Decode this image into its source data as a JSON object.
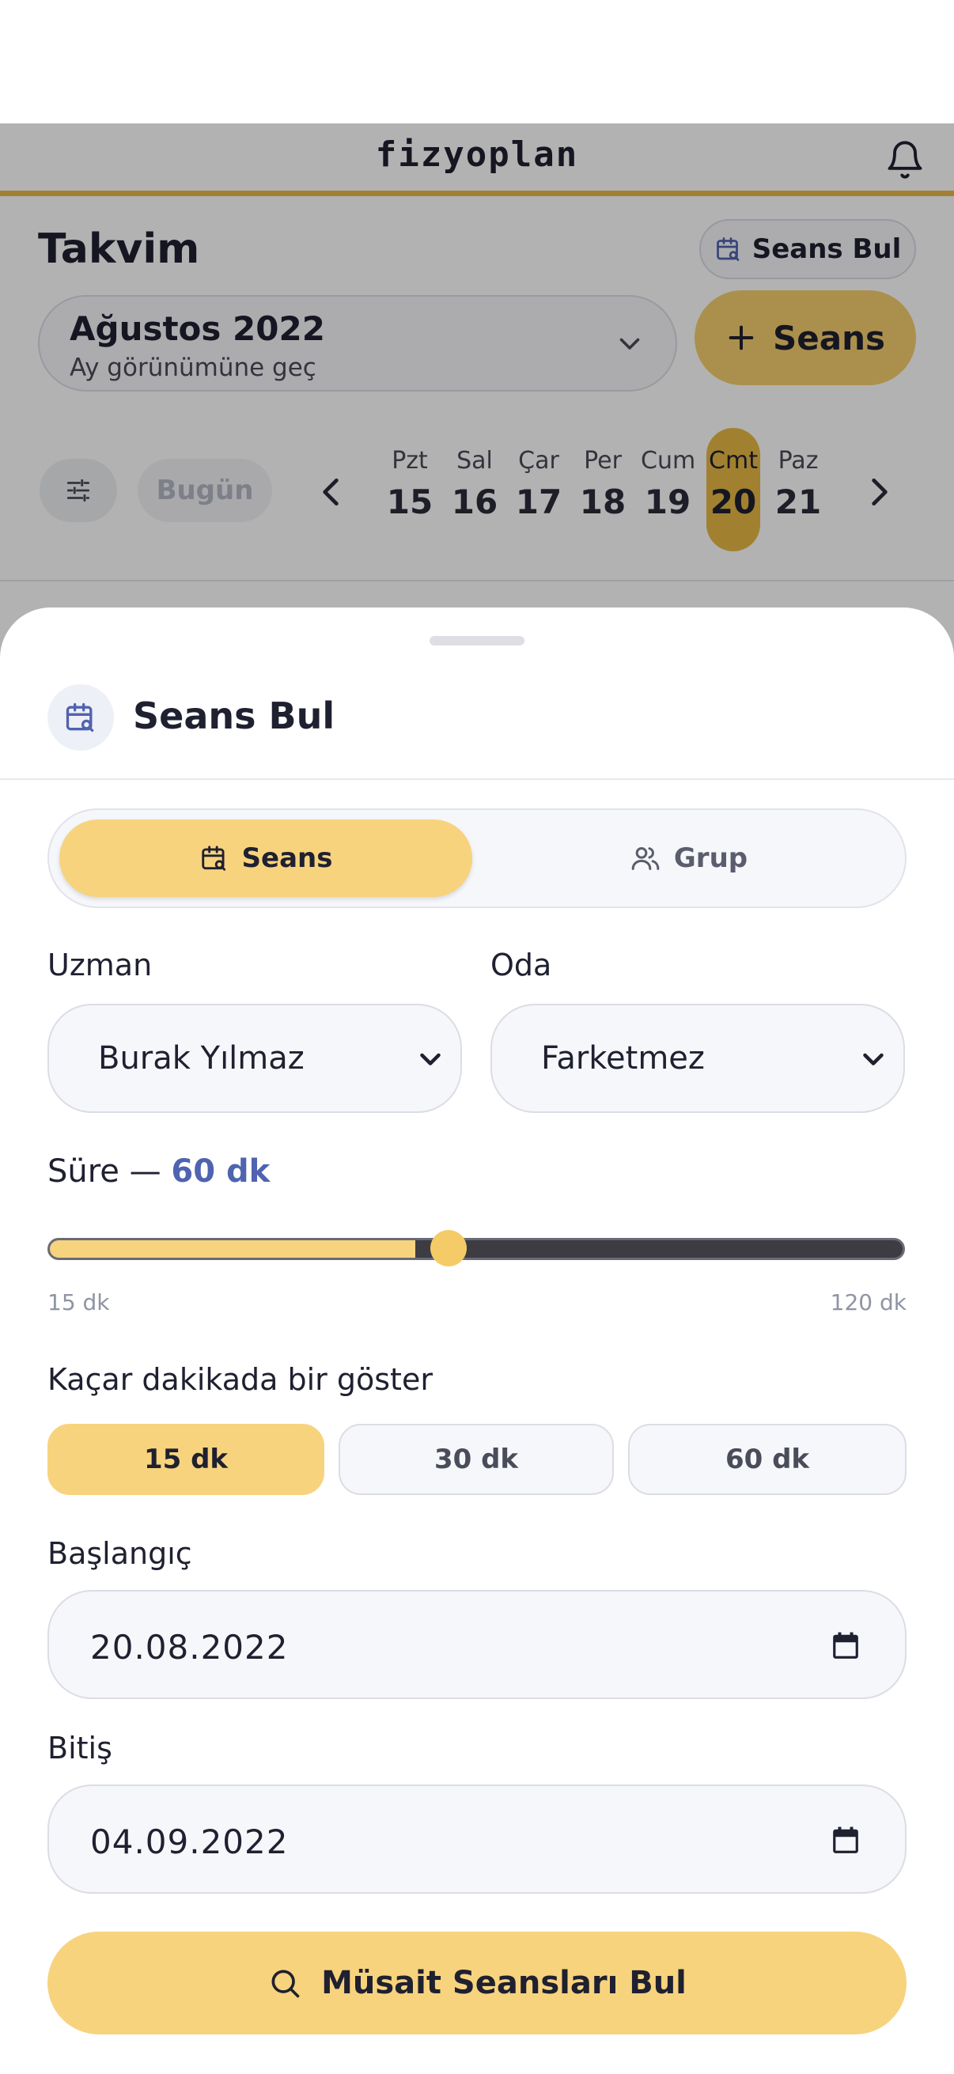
{
  "app": {
    "logo": "fizyoplan"
  },
  "header": {
    "title": "Takvim",
    "find_label": "Seans Bul",
    "month_title": "Ağustos 2022",
    "month_sub": "Ay görünümüne geç",
    "new_label": "Seans",
    "today_label": "Bugün"
  },
  "week": {
    "days": [
      {
        "name": "Pzt",
        "date": "15"
      },
      {
        "name": "Sal",
        "date": "16"
      },
      {
        "name": "Çar",
        "date": "17"
      },
      {
        "name": "Per",
        "date": "18"
      },
      {
        "name": "Cum",
        "date": "19"
      },
      {
        "name": "Cmt",
        "date": "20"
      },
      {
        "name": "Paz",
        "date": "21"
      }
    ],
    "selected_index": 5
  },
  "sheet": {
    "title": "Seans Bul",
    "tabs": [
      {
        "label": "Seans",
        "active": true
      },
      {
        "label": "Grup",
        "active": false
      }
    ],
    "specialist_label": "Uzman",
    "specialist_value": "Burak Yılmaz",
    "room_label": "Oda",
    "room_value": "Farketmez",
    "duration_prefix": "Süre —",
    "duration_value": "60 dk",
    "slider": {
      "min": 15,
      "max": 120,
      "value": 60,
      "min_label": "15 dk",
      "max_label": "120 dk"
    },
    "step_label": "Kaçar dakikada bir göster",
    "steps": [
      {
        "label": "15 dk",
        "active": true
      },
      {
        "label": "30 dk",
        "active": false
      },
      {
        "label": "60 dk",
        "active": false
      }
    ],
    "start_label": "Başlangıç",
    "start_value": "20.08.2022",
    "end_label": "Bitiş",
    "end_value": "04.09.2022",
    "submit_label": "Müsait Seansları Bul"
  },
  "colors": {
    "accent": "#f7d37d",
    "accent_strong": "#e7b946",
    "link": "#4f63b0"
  }
}
